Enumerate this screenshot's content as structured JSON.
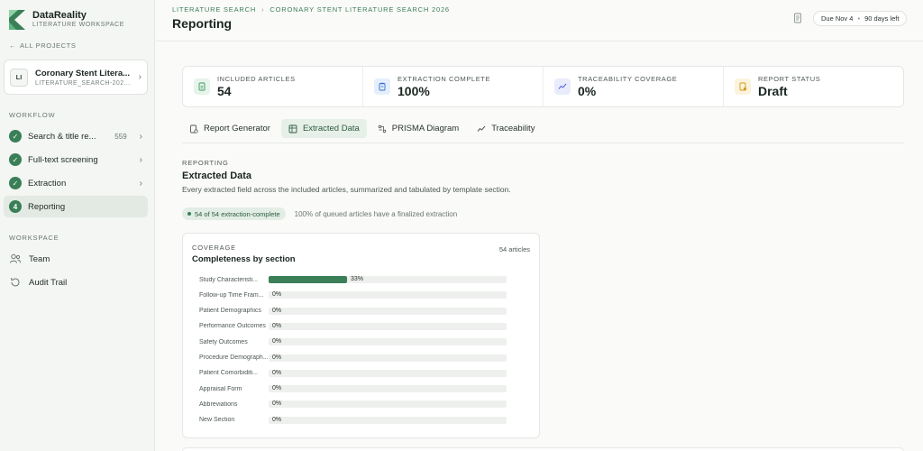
{
  "brand": {
    "name": "DataReality",
    "subtitle": "LITERATURE WORKSPACE"
  },
  "sidebar": {
    "back_label": "ALL PROJECTS",
    "project": {
      "avatar": "LI",
      "name": "Coronary Stent Litera...",
      "id": "LITERATURE_SEARCH-202..."
    },
    "workflow_label": "WORKFLOW",
    "workflow": [
      {
        "label": "Search & title re...",
        "count": "559",
        "state": "done"
      },
      {
        "label": "Full-text screening",
        "count": "",
        "state": "done"
      },
      {
        "label": "Extraction",
        "count": "",
        "state": "done"
      },
      {
        "label": "Reporting",
        "step": "4",
        "state": "active"
      }
    ],
    "workspace_label": "WORKSPACE",
    "workspace": [
      {
        "label": "Team",
        "icon": "team-icon"
      },
      {
        "label": "Audit Trail",
        "icon": "audit-trail-icon"
      }
    ]
  },
  "header": {
    "breadcrumb": [
      "LITERATURE SEARCH",
      "CORONARY STENT LITERATURE SEARCH 2026"
    ],
    "title": "Reporting",
    "due_label": "Due Nov 4",
    "days_left": "90 days left"
  },
  "stats": [
    {
      "label": "INCLUDED ARTICLES",
      "value": "54",
      "icon": "document-icon",
      "color": "#3a9a5e",
      "bg": "#e6f4ea"
    },
    {
      "label": "EXTRACTION COMPLETE",
      "value": "100%",
      "icon": "clipboard-icon",
      "color": "#2f6fd6",
      "bg": "#e5eefb"
    },
    {
      "label": "TRACEABILITY COVERAGE",
      "value": "0%",
      "icon": "trend-icon",
      "color": "#4a5ee0",
      "bg": "#e9ecfb"
    },
    {
      "label": "REPORT STATUS",
      "value": "Draft",
      "icon": "report-status-icon",
      "color": "#d29a1d",
      "bg": "#fcf3dc"
    }
  ],
  "tabs": [
    {
      "label": "Report Generator",
      "icon": "report-generator-icon",
      "active": false
    },
    {
      "label": "Extracted Data",
      "icon": "table-icon",
      "active": true
    },
    {
      "label": "PRISMA Diagram",
      "icon": "diagram-icon",
      "active": false
    },
    {
      "label": "Traceability",
      "icon": "trend-icon",
      "active": false
    }
  ],
  "section": {
    "label": "REPORTING",
    "title": "Extracted Data",
    "description": "Every extracted field across the included articles, summarized and tabulated by template section.",
    "status_pill": "54 of 54 extraction-complete",
    "status_note": "100% of queued articles have a finalized extraction"
  },
  "coverage": {
    "label": "COVERAGE",
    "title": "Completeness by section",
    "count": "54 articles",
    "rows": [
      {
        "label": "Study Characteristi...",
        "pct": 33,
        "pct_label": "33%"
      },
      {
        "label": "Follow-up Time Fram...",
        "pct": 0,
        "pct_label": "0%"
      },
      {
        "label": "Patient Demographics",
        "pct": 0,
        "pct_label": "0%"
      },
      {
        "label": "Performance Outcomes",
        "pct": 0,
        "pct_label": "0%"
      },
      {
        "label": "Safety Outcomes",
        "pct": 0,
        "pct_label": "0%"
      },
      {
        "label": "Procedure Demograph...",
        "pct": 0,
        "pct_label": "0%"
      },
      {
        "label": "Patient Comorbiditi...",
        "pct": 0,
        "pct_label": "0%"
      },
      {
        "label": "Appraisal Form",
        "pct": 0,
        "pct_label": "0%"
      },
      {
        "label": "Abbreviations",
        "pct": 0,
        "pct_label": "0%"
      },
      {
        "label": "New Section",
        "pct": 0,
        "pct_label": "0%"
      }
    ]
  },
  "colors": {
    "accent": "#3a7f57",
    "accent_light": "#e6efe8"
  }
}
